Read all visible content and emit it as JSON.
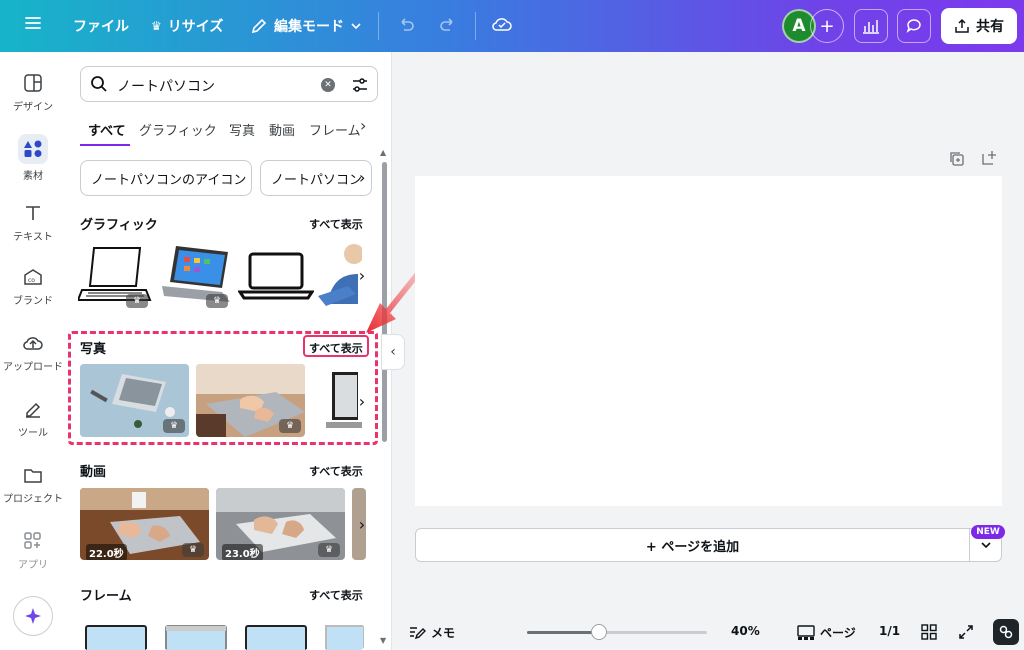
{
  "topbar": {
    "file": "ファイル",
    "resize": "リサイズ",
    "edit_mode": "編集モード",
    "avatar": "A",
    "share": "共有"
  },
  "rail": [
    {
      "label": "デザイン",
      "icon": "design-icon"
    },
    {
      "label": "素材",
      "icon": "elements-icon"
    },
    {
      "label": "テキスト",
      "icon": "text-icon"
    },
    {
      "label": "ブランド",
      "icon": "brand-icon"
    },
    {
      "label": "アップロード",
      "icon": "upload-icon"
    },
    {
      "label": "ツール",
      "icon": "tools-icon"
    },
    {
      "label": "プロジェクト",
      "icon": "projects-icon"
    },
    {
      "label": "アプリ",
      "icon": "apps-icon"
    }
  ],
  "panel": {
    "search_value": "ノートパソコン",
    "tabs": [
      "すべて",
      "グラフィック",
      "写真",
      "動画",
      "フレーム"
    ],
    "chips": [
      "ノートパソコンのアイコン",
      "ノートパソコン"
    ],
    "sections": {
      "graphics": {
        "title": "グラフィック",
        "see_all": "すべて表示"
      },
      "photos": {
        "title": "写真",
        "see_all": "すべて表示"
      },
      "videos": {
        "title": "動画",
        "see_all": "すべて表示",
        "durations": [
          "22.0秒",
          "23.0秒"
        ]
      },
      "frames": {
        "title": "フレーム",
        "see_all": "すべて表示"
      }
    }
  },
  "canvas": {
    "add_page": "+ ページを追加",
    "new_badge": "NEW"
  },
  "bottombar": {
    "memo": "メモ",
    "zoom": "40%",
    "zoom_fraction": 0.4,
    "pages_label": "ページ",
    "page_count": "1/1"
  },
  "colors": {
    "accent": "#7d2ae8",
    "highlight": "#e8336b",
    "arrow": "#e8292f"
  }
}
